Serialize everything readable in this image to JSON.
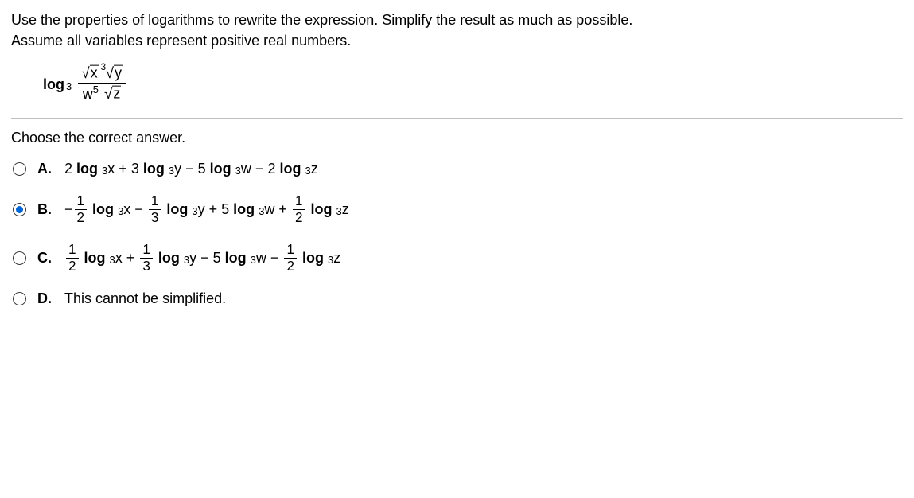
{
  "instructions_line1": "Use the properties of logarithms to rewrite the expression. Simplify the result as much as possible.",
  "instructions_line2": "Assume all variables represent positive real numbers.",
  "expr": {
    "log_label": "log",
    "base": "3",
    "num_x": "x",
    "num_y": "y",
    "num_y_idx": "3",
    "den_w": "w",
    "den_w_exp": "5",
    "den_z": "z"
  },
  "prompt": "Choose the correct answer.",
  "selected": "B",
  "letters": {
    "A": "A.",
    "B": "B.",
    "C": "C.",
    "D": "D."
  },
  "A": {
    "t1": "2",
    "t2": "log",
    "t3": "3",
    "t4": "x",
    "t5": "+",
    "t6": "3",
    "t7": "log",
    "t8": "3",
    "t9": "y",
    "t10": "−",
    "t11": "5",
    "t12": "log",
    "t13": "3",
    "t14": "w",
    "t15": "−",
    "t16": "2",
    "t17": "log",
    "t18": "3",
    "t19": "z"
  },
  "B": {
    "m0": "−",
    "f1n": "1",
    "f1d": "2",
    "t2": "log",
    "t3": "3",
    "t4": "x",
    "t5": "−",
    "f2n": "1",
    "f2d": "3",
    "t7": "log",
    "t8": "3",
    "t9": "y",
    "t10": "+",
    "t11": "5",
    "t12": "log",
    "t13": "3",
    "t14": "w",
    "t15": "+",
    "f3n": "1",
    "f3d": "2",
    "t17": "log",
    "t18": "3",
    "t19": "z"
  },
  "C": {
    "f1n": "1",
    "f1d": "2",
    "t2": "log",
    "t3": "3",
    "t4": "x",
    "t5": "+",
    "f2n": "1",
    "f2d": "3",
    "t7": "log",
    "t8": "3",
    "t9": "y",
    "t10": "−",
    "t11": "5",
    "t12": "log",
    "t13": "3",
    "t14": "w",
    "t15": "−",
    "f3n": "1",
    "f3d": "2",
    "t17": "log",
    "t18": "3",
    "t19": "z"
  },
  "D": {
    "text": "This cannot be simplified."
  }
}
